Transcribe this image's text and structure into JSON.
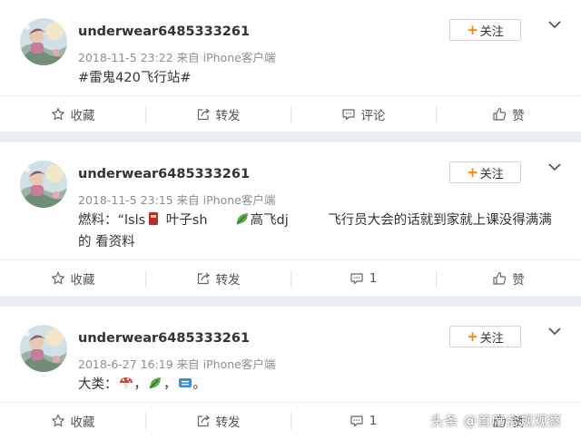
{
  "posts": [
    {
      "username": "underwear6485333261",
      "meta": "2018-11-5 23:22 来自 iPhone客户端",
      "content": "#雷鬼420飞行站#",
      "follow_label": "关注",
      "follow_plus": "+",
      "actions": {
        "favorite": "收藏",
        "forward": "转发",
        "comment": "评论",
        "like": "赞"
      }
    },
    {
      "username": "underwear6485333261",
      "meta": "2018-11-5 23:15 来自 iPhone客户端",
      "content_a": "燃料：“lsls",
      "content_b": "叶子sh",
      "content_c": "高飞dj",
      "content_d": "飞行员大会的话就到家就上课没得满满",
      "content_line2": "的 看资料",
      "follow_label": "关注",
      "follow_plus": "+",
      "actions": {
        "favorite": "收藏",
        "forward": "转发",
        "comment": "1",
        "like": "赞"
      }
    },
    {
      "username": "underwear6485333261",
      "meta": "2018-6-27 16:19 来自 iPhone客户端",
      "content_a": "大类：",
      "content_sep": "，",
      "content_end": "。",
      "follow_label": "关注",
      "follow_plus": "+",
      "actions": {
        "favorite": "收藏",
        "forward": "转发",
        "comment": "1",
        "like": "赞"
      }
    }
  ],
  "watermark": "头条 @首席合规观察",
  "icons": [
    "star-icon",
    "forward-icon",
    "comment-icon",
    "like-icon",
    "chevron-down-icon",
    "mushroom-emoji",
    "leaf-emoji",
    "ticket-emoji",
    "red-box-emoji"
  ],
  "colors": {
    "accent": "#ff8200",
    "background": "#e9eef3",
    "meta": "#8e8e8e"
  }
}
